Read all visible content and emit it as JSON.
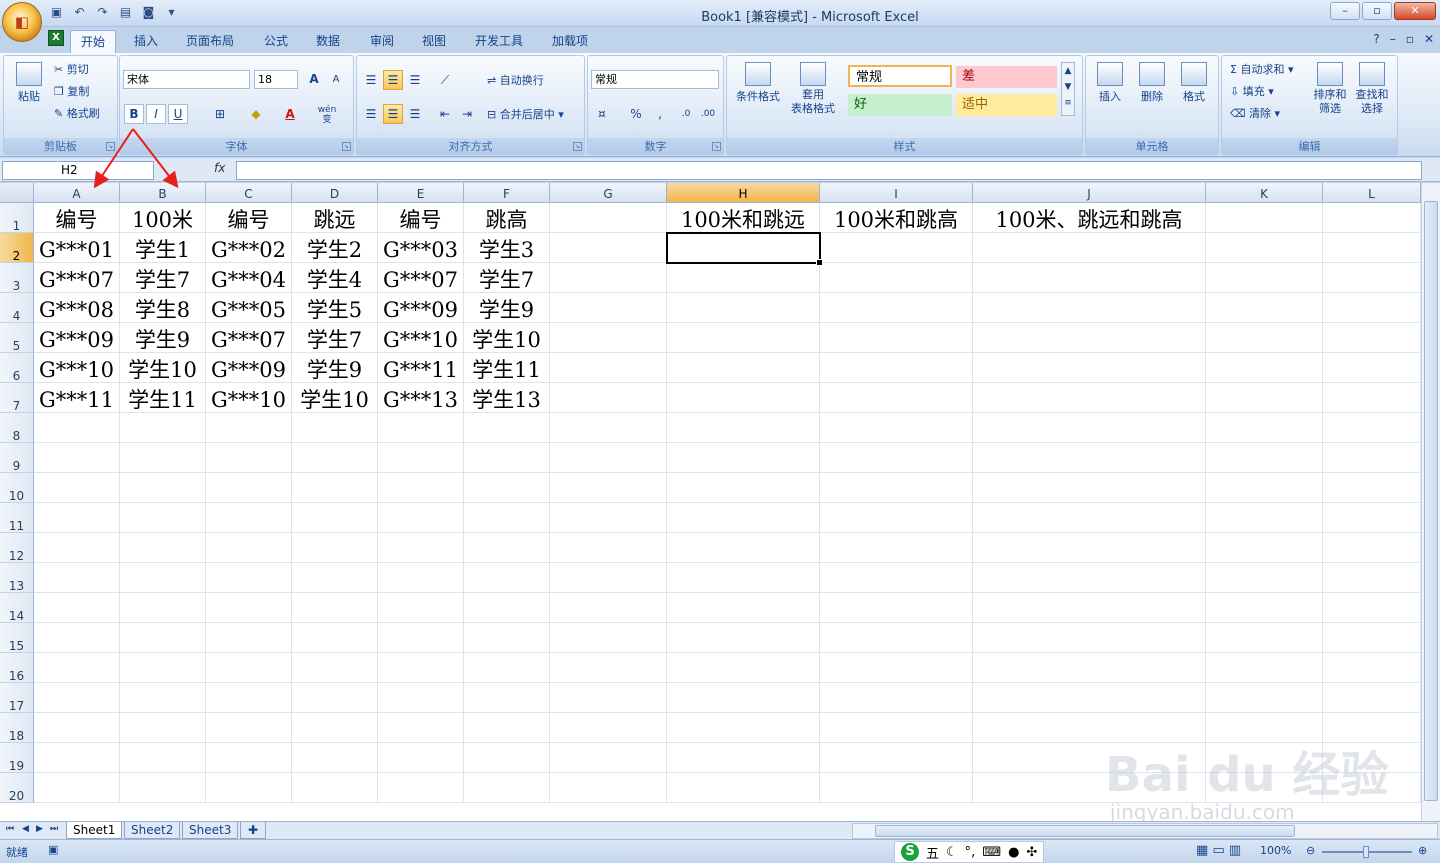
{
  "window": {
    "title": "Book1  [兼容模式] - Microsoft Excel",
    "controls": [
      "–",
      "▫",
      "✕"
    ]
  },
  "qat": {
    "icons": [
      "save-icon",
      "undo-icon",
      "redo-icon",
      "print-preview-icon",
      "camera-icon"
    ]
  },
  "tabs": [
    "开始",
    "插入",
    "页面布局",
    "公式",
    "数据",
    "审阅",
    "视图",
    "开发工具",
    "加载项"
  ],
  "ribbon": {
    "clipboard": {
      "paste": "粘贴",
      "cut": "剪切",
      "copy": "复制",
      "format_painter": "格式刷",
      "label": "剪贴板"
    },
    "font": {
      "name": "宋体",
      "size": "18",
      "grow": "A",
      "shrink": "A",
      "bold": "B",
      "italic": "I",
      "underline": "U",
      "phonetic": "wén",
      "phonetic_char": "变",
      "label": "字体"
    },
    "alignment": {
      "wrap": "自动换行",
      "merge": "合并后居中",
      "label": "对齐方式"
    },
    "number": {
      "format": "常规",
      "percent": "%",
      "comma": ",",
      "label": "数字"
    },
    "styles": {
      "conditional": "条件格式",
      "table1": "套用",
      "table2": "表格格式",
      "normal": "常规",
      "bad": "差",
      "good": "好",
      "neutral": "适中",
      "label": "样式"
    },
    "cells": {
      "insert": "插入",
      "delete": "删除",
      "format": "格式",
      "label": "单元格"
    },
    "editing": {
      "autosum": "自动求和",
      "fill": "填充",
      "clear": "清除",
      "sort1": "排序和",
      "sort2": "筛选",
      "find1": "查找和",
      "find2": "选择",
      "label": "编辑"
    }
  },
  "formula_bar": {
    "name_box": "H2",
    "fx": "fx",
    "value": ""
  },
  "columns": [
    "A",
    "B",
    "C",
    "D",
    "E",
    "F",
    "G",
    "H",
    "I",
    "J",
    "K",
    "L"
  ],
  "rows": [
    "1",
    "2",
    "3",
    "4",
    "5",
    "6",
    "7",
    "8",
    "9",
    "10",
    "11",
    "12",
    "13",
    "14",
    "15",
    "16",
    "17",
    "18",
    "19",
    "20"
  ],
  "cells": {
    "r1": [
      "编号",
      "100米",
      "编号",
      "跳远",
      "编号",
      "跳高",
      "",
      "100米和跳远",
      "100米和跳高",
      "100米、跳远和跳高"
    ],
    "r2": [
      "G***01",
      "学生1",
      "G***02",
      "学生2",
      "G***03",
      "学生3"
    ],
    "r3": [
      "G***07",
      "学生7",
      "G***04",
      "学生4",
      "G***07",
      "学生7"
    ],
    "r4": [
      "G***08",
      "学生8",
      "G***05",
      "学生5",
      "G***09",
      "学生9"
    ],
    "r5": [
      "G***09",
      "学生9",
      "G***07",
      "学生7",
      "G***10",
      "学生10"
    ],
    "r6": [
      "G***10",
      "学生10",
      "G***09",
      "学生9",
      "G***11",
      "学生11"
    ],
    "r7": [
      "G***11",
      "学生11",
      "G***10",
      "学生10",
      "G***13",
      "学生13"
    ]
  },
  "sheets": [
    "Sheet1",
    "Sheet2",
    "Sheet3"
  ],
  "status": {
    "ready": "就绪",
    "zoom": "100%"
  },
  "ime": {
    "mode": "五"
  },
  "watermark": {
    "text": "Bai du 经验",
    "url": "jingyan.baidu.com"
  },
  "colors": {
    "arrow": "#e8201a",
    "selected_header": "#f1b64b"
  }
}
